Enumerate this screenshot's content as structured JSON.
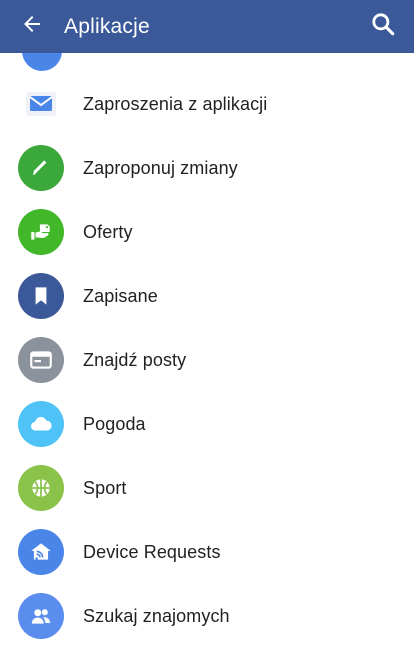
{
  "header": {
    "title": "Aplikacje"
  },
  "items": [
    {
      "label": "Zaproszenia z aplikacji",
      "icon": "envelope-icon",
      "color": "#f1f3f6"
    },
    {
      "label": "Zaproponuj zmiany",
      "icon": "pencil-icon",
      "color": "#3aa83a"
    },
    {
      "label": "Oferty",
      "icon": "offer-hand-icon",
      "color": "#42b72a"
    },
    {
      "label": "Zapisane",
      "icon": "bookmark-icon",
      "color": "#3b5998"
    },
    {
      "label": "Znajdź posty",
      "icon": "browser-window-icon",
      "color": "#8b929c"
    },
    {
      "label": "Pogoda",
      "icon": "cloud-icon",
      "color": "#4fc3f7"
    },
    {
      "label": "Sport",
      "icon": "ball-icon",
      "color": "#8bc34a"
    },
    {
      "label": "Device Requests",
      "icon": "home-wifi-icon",
      "color": "#4a86e8"
    },
    {
      "label": "Szukaj znajomych",
      "icon": "people-icon",
      "color": "#5b8def"
    }
  ],
  "colors": {
    "appbar": "#3b5998",
    "text": "#222222"
  }
}
